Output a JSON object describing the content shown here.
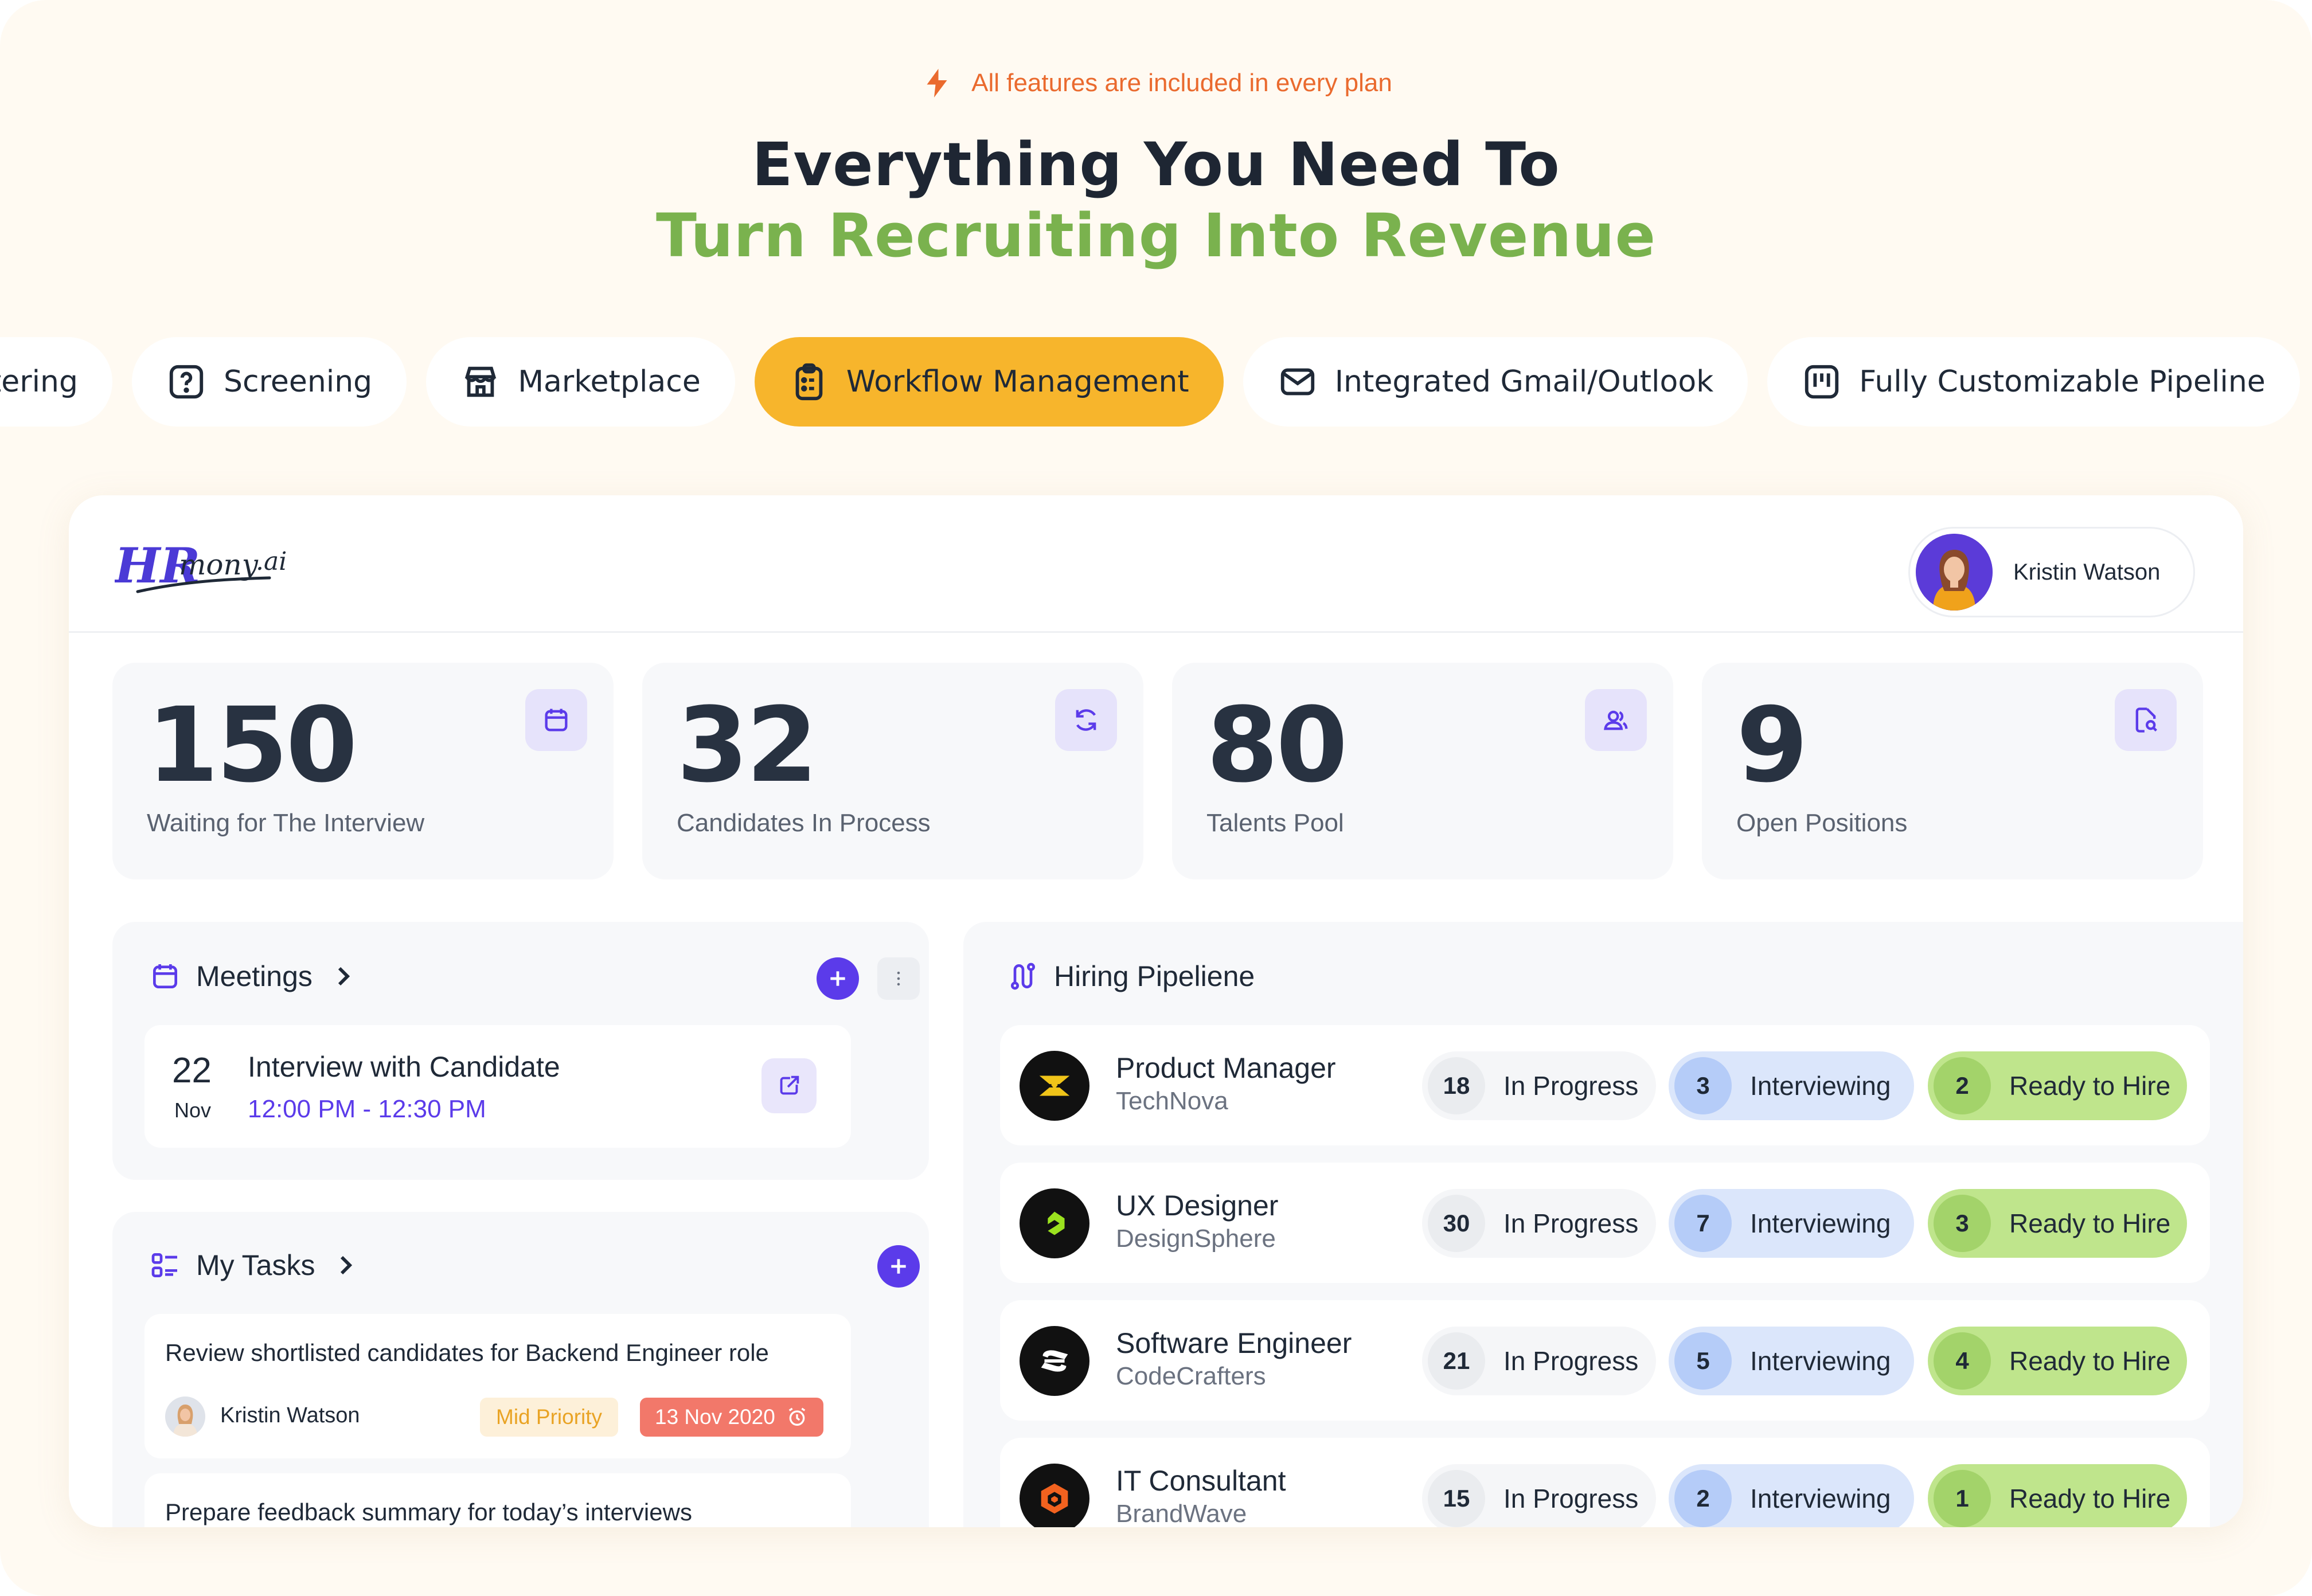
{
  "hero": {
    "eyebrow": "All features are included in every plan",
    "title_line1": "Everything You Need To",
    "title_line2": "Turn Recruiting Into Revenue"
  },
  "tabs": [
    {
      "label": "tering",
      "icon": "filter-icon"
    },
    {
      "label": "Screening",
      "icon": "question-icon"
    },
    {
      "label": "Marketplace",
      "icon": "store-icon"
    },
    {
      "label": "Workflow  Management",
      "icon": "clipboard-icon",
      "active": true
    },
    {
      "label": "Integrated Gmail/Outlook",
      "icon": "mail-icon"
    },
    {
      "label": "Fully Customizable Pipeline",
      "icon": "kanban-icon"
    }
  ],
  "app": {
    "logo_text": "HRmony.ai",
    "user_name": "Kristin Watson"
  },
  "stats": [
    {
      "value": "150",
      "label": "Waiting for The Interview",
      "icon": "calendar-icon"
    },
    {
      "value": "32",
      "label": "Candidates In Process",
      "icon": "refresh-icon"
    },
    {
      "value": "80",
      "label": "Talents Pool",
      "icon": "users-icon"
    },
    {
      "value": "9",
      "label": "Open Positions",
      "icon": "file-search-icon"
    }
  ],
  "meetings": {
    "title": "Meetings",
    "item": {
      "day": "22",
      "month": "Nov",
      "title": "Interview with Candidate",
      "time": "12:00 PM - 12:30 PM"
    }
  },
  "tasks": {
    "title": "My Tasks",
    "items": [
      {
        "text": "Review shortlisted candidates for Backend Engineer role",
        "user": "Kristin Watson",
        "priority": "Mid Priority",
        "due": "13 Nov 2020"
      },
      {
        "text": "Prepare feedback summary for today’s interviews"
      }
    ]
  },
  "pipeline": {
    "title": "Hiring Pipeliene",
    "stage_labels": {
      "progress": "In Progress",
      "interviewing": "Interviewing",
      "hire": "Ready to Hire"
    },
    "rows": [
      {
        "role": "Product Manager",
        "company": "TechNova",
        "progress": "18",
        "interviewing": "3",
        "hire": "2"
      },
      {
        "role": "UX Designer",
        "company": "DesignSphere",
        "progress": "30",
        "interviewing": "7",
        "hire": "3"
      },
      {
        "role": "Software Engineer",
        "company": "CodeCrafters",
        "progress": "21",
        "interviewing": "5",
        "hire": "4"
      },
      {
        "role": "IT Consultant",
        "company": "BrandWave",
        "progress": "15",
        "interviewing": "2",
        "hire": "1"
      }
    ]
  },
  "colors": {
    "accent": "#5b3bea",
    "brand_orange": "#ea6a2e",
    "brand_green": "#7ab24e",
    "active_tab": "#f7b52c"
  }
}
